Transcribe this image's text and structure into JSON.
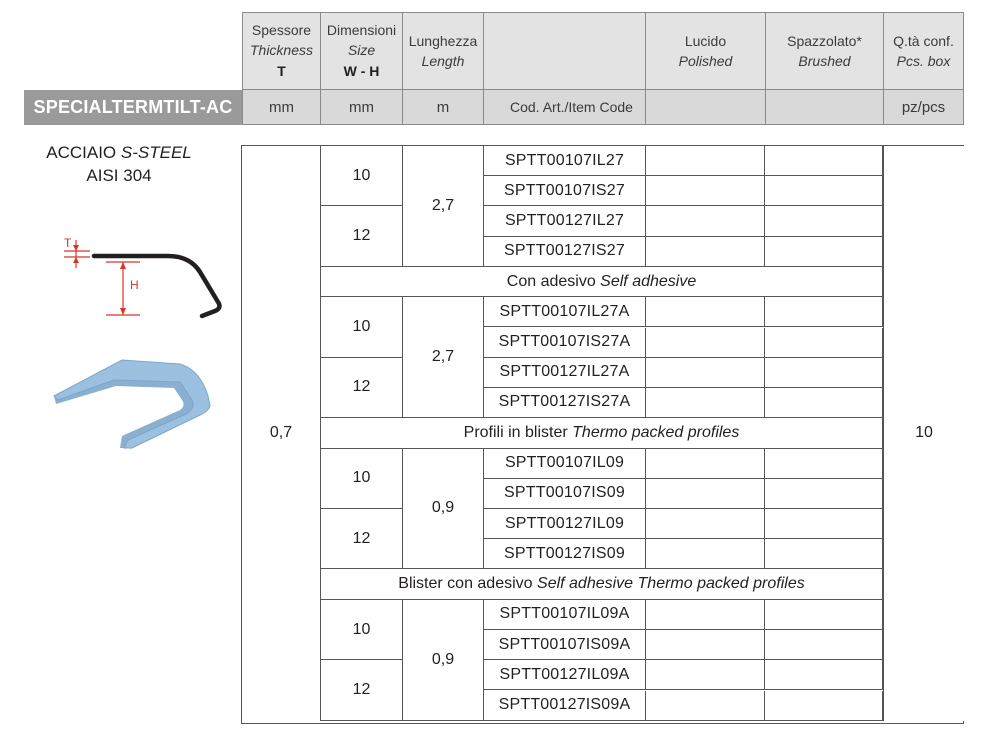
{
  "header": {
    "thickness": {
      "it_label": "Spessore",
      "en_label": "Thickness",
      "symbol": "T"
    },
    "size": {
      "it_label": "Dimensioni",
      "en_label": "Size",
      "symbol": "W - H"
    },
    "length": {
      "it_label": "Lunghezza",
      "en_label": "Length"
    },
    "polished": {
      "it_label": "Lucido",
      "en_label": "Polished"
    },
    "brushed": {
      "it_label": "Spazzolato*",
      "en_label": "Brushed"
    },
    "qty": {
      "it_label": "Q.tà conf.",
      "en_label": "Pcs. box"
    }
  },
  "units": {
    "brand": "SPECIALTERMTILT-AC",
    "thickness": "mm",
    "size": "mm",
    "length": "m",
    "code": "Cod. Art./Item Code",
    "qty": "pz/pcs"
  },
  "material": {
    "line1_it": "ACCIAIO",
    "line1_en": "S-STEEL",
    "line2": "AISI 304"
  },
  "drawing": {
    "t_label": "T",
    "h_label": "H"
  },
  "table": {
    "thickness_value": "0,7",
    "qty_value": "10",
    "groups": [
      {
        "length": "2,7",
        "sizes": [
          {
            "size": "10",
            "codes": [
              "SPTT00107IL27",
              "SPTT00107IS27"
            ]
          },
          {
            "size": "12",
            "codes": [
              "SPTT00127IL27",
              "SPTT00127IS27"
            ]
          }
        ]
      },
      {
        "section_it": "Con adesivo",
        "section_en": "Self adhesive",
        "length": "2,7",
        "sizes": [
          {
            "size": "10",
            "codes": [
              "SPTT00107IL27A",
              "SPTT00107IS27A"
            ]
          },
          {
            "size": "12",
            "codes": [
              "SPTT00127IL27A",
              "SPTT00127IS27A"
            ]
          }
        ]
      },
      {
        "section_it": "Profili in blister",
        "section_en": "Thermo packed profiles",
        "length": "0,9",
        "sizes": [
          {
            "size": "10",
            "codes": [
              "SPTT00107IL09",
              "SPTT00107IS09"
            ]
          },
          {
            "size": "12",
            "codes": [
              "SPTT00127IL09",
              "SPTT00127IS09"
            ]
          }
        ]
      },
      {
        "section_it": "Blister con adesivo",
        "section_en": "Self adhesive Thermo packed profiles",
        "length": "0,9",
        "sizes": [
          {
            "size": "10",
            "codes": [
              "SPTT00107IL09A",
              "SPTT00107IS09A"
            ]
          },
          {
            "size": "12",
            "codes": [
              "SPTT00127IL09A",
              "SPTT00127IS09A"
            ]
          }
        ]
      }
    ]
  },
  "colors": {
    "header_bg": "#e3e3e3",
    "brand_bg": "#9a9a9a",
    "unit_bg": "#d9d9d9",
    "profile_blue": "#9cc1e0",
    "dimension_red": "#d9332a"
  }
}
